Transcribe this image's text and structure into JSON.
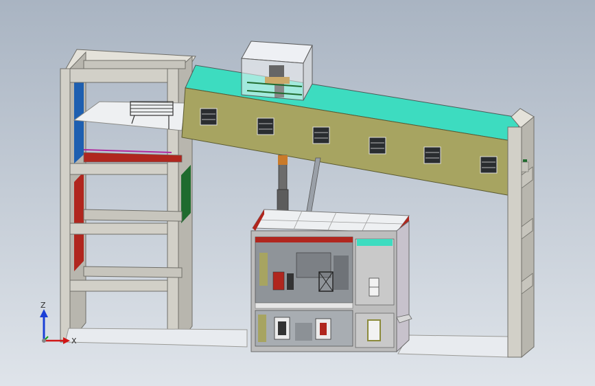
{
  "viewport": {
    "background_top": "#a9b4c2",
    "background_bottom": "#dfe4ea"
  },
  "model": {
    "frame_color": "#d2d0c8",
    "conveyor_top_color": "#3ddcc0",
    "conveyor_side_color": "#a7a461",
    "house_color": "#bdbdbd",
    "accent_red": "#b0261e",
    "accent_green": "#1f6b2e",
    "accent_blue": "#1e5fb0",
    "accent_magenta": "#b02a9e"
  },
  "triad": {
    "z_label": "Z",
    "x_label": "X",
    "z_color": "#1a3fd6",
    "x_color": "#d01616",
    "y_color": "#14a01a"
  }
}
